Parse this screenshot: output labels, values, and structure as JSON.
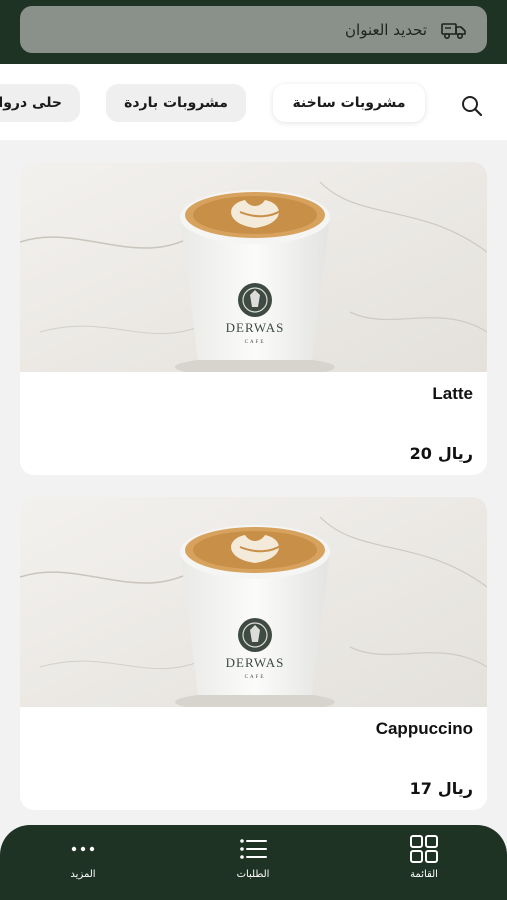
{
  "header": {
    "address_label": "تحديد العنوان",
    "icon": "delivery-truck-icon"
  },
  "categories": [
    {
      "label": "مشروبات ساخنة",
      "active": true
    },
    {
      "label": "مشروبات باردة",
      "active": false
    },
    {
      "label": "حلى درواس",
      "active": false
    }
  ],
  "search_icon": "search-icon",
  "products": [
    {
      "name": "Latte",
      "price": "20",
      "currency": "ريال",
      "cup_brand": "DERWAS",
      "cup_sub": "CAFE"
    },
    {
      "name": "Cappuccino",
      "price": "17",
      "currency": "ريال",
      "cup_brand": "DERWAS",
      "cup_sub": "CAFE"
    }
  ],
  "bottom_nav": [
    {
      "label": "القائمة",
      "icon": "grid-icon"
    },
    {
      "label": "الطلبات",
      "icon": "list-icon"
    },
    {
      "label": "المزيد",
      "icon": "more-dots-icon"
    }
  ],
  "colors": {
    "brand_dark": "#1f3325",
    "address_bar": "#8a918a"
  }
}
